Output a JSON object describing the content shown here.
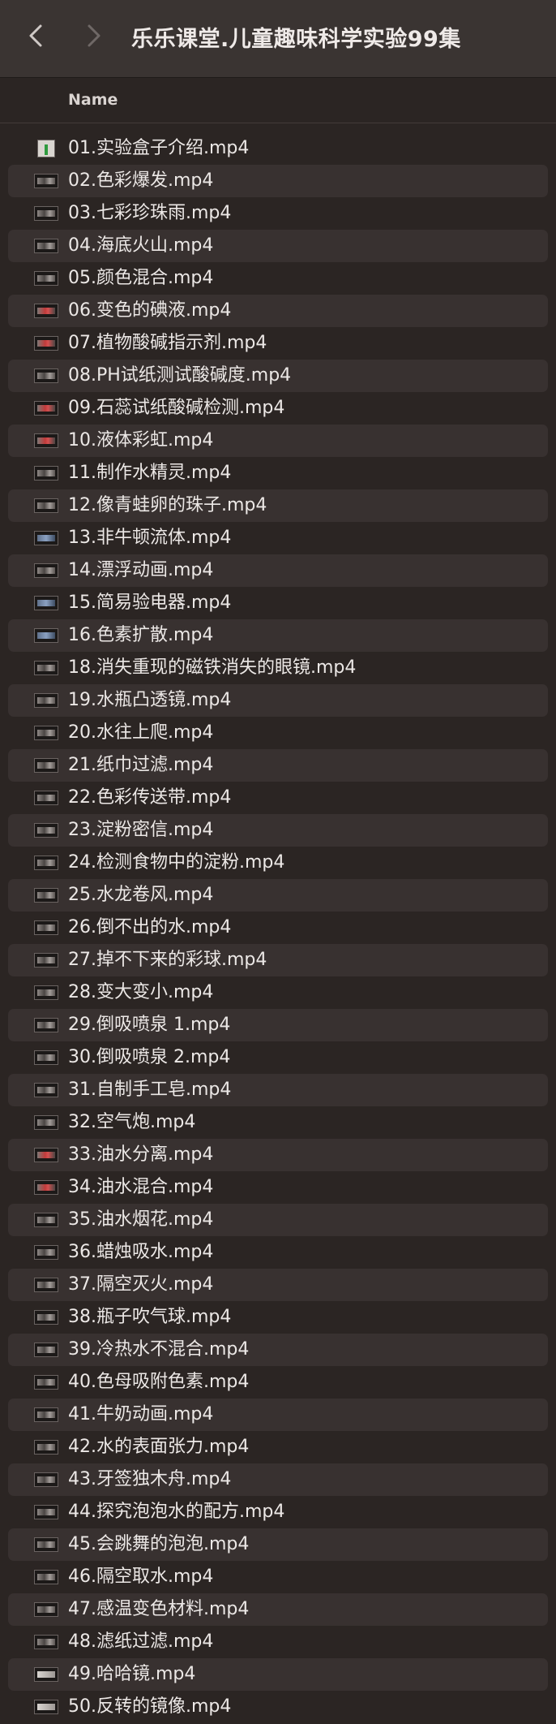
{
  "window": {
    "title": "乐乐课堂.儿童趣味科学实验99集",
    "back_icon": "chevron-left-icon",
    "forward_icon": "chevron-right-icon"
  },
  "columns": {
    "name": "Name"
  },
  "files": [
    "01.实验盒子介绍.mp4",
    "02.色彩爆发.mp4",
    "03.七彩珍珠雨.mp4",
    "04.海底火山.mp4",
    "05.颜色混合.mp4",
    "06.变色的碘液.mp4",
    "07.植物酸碱指示剂.mp4",
    "08.PH试纸测试酸碱度.mp4",
    "09.石蕊试纸酸碱检测.mp4",
    "10.液体彩虹.mp4",
    "11.制作水精灵.mp4",
    "12.像青蛙卵的珠子.mp4",
    "13.非牛顿流体.mp4",
    "14.漂浮动画.mp4",
    "15.简易验电器.mp4",
    "16.色素扩散.mp4",
    "18.消失重现的磁铁消失的眼镜.mp4",
    "19.水瓶凸透镜.mp4",
    "20.水往上爬.mp4",
    "21.纸巾过滤.mp4",
    "22.色彩传送带.mp4",
    "23.淀粉密信.mp4",
    "24.检测食物中的淀粉.mp4",
    "25.水龙卷风.mp4",
    "26.倒不出的水.mp4",
    "27.掉不下来的彩球.mp4",
    "28.变大变小.mp4",
    "29.倒吸喷泉 1.mp4",
    "30.倒吸喷泉 2.mp4",
    "31.自制手工皂.mp4",
    "32.空气炮.mp4",
    "33.油水分离.mp4",
    "34.油水混合.mp4",
    "35.油水烟花.mp4",
    "36.蜡烛吸水.mp4",
    "37.隔空灭火.mp4",
    "38.瓶子吹气球.mp4",
    "39.冷热水不混合.mp4",
    "40.色母吸附色素.mp4",
    "41.牛奶动画.mp4",
    "42.水的表面张力.mp4",
    "43.牙签独木舟.mp4",
    "44.探究泡泡水的配方.mp4",
    "45.会跳舞的泡泡.mp4",
    "46.隔空取水.mp4",
    "47.感温变色材料.mp4",
    "48.滤纸过滤.mp4",
    "49.哈哈镜.mp4",
    "50.反转的镜像.mp4"
  ],
  "thumbnail_icon": "video-thumbnail-icon"
}
